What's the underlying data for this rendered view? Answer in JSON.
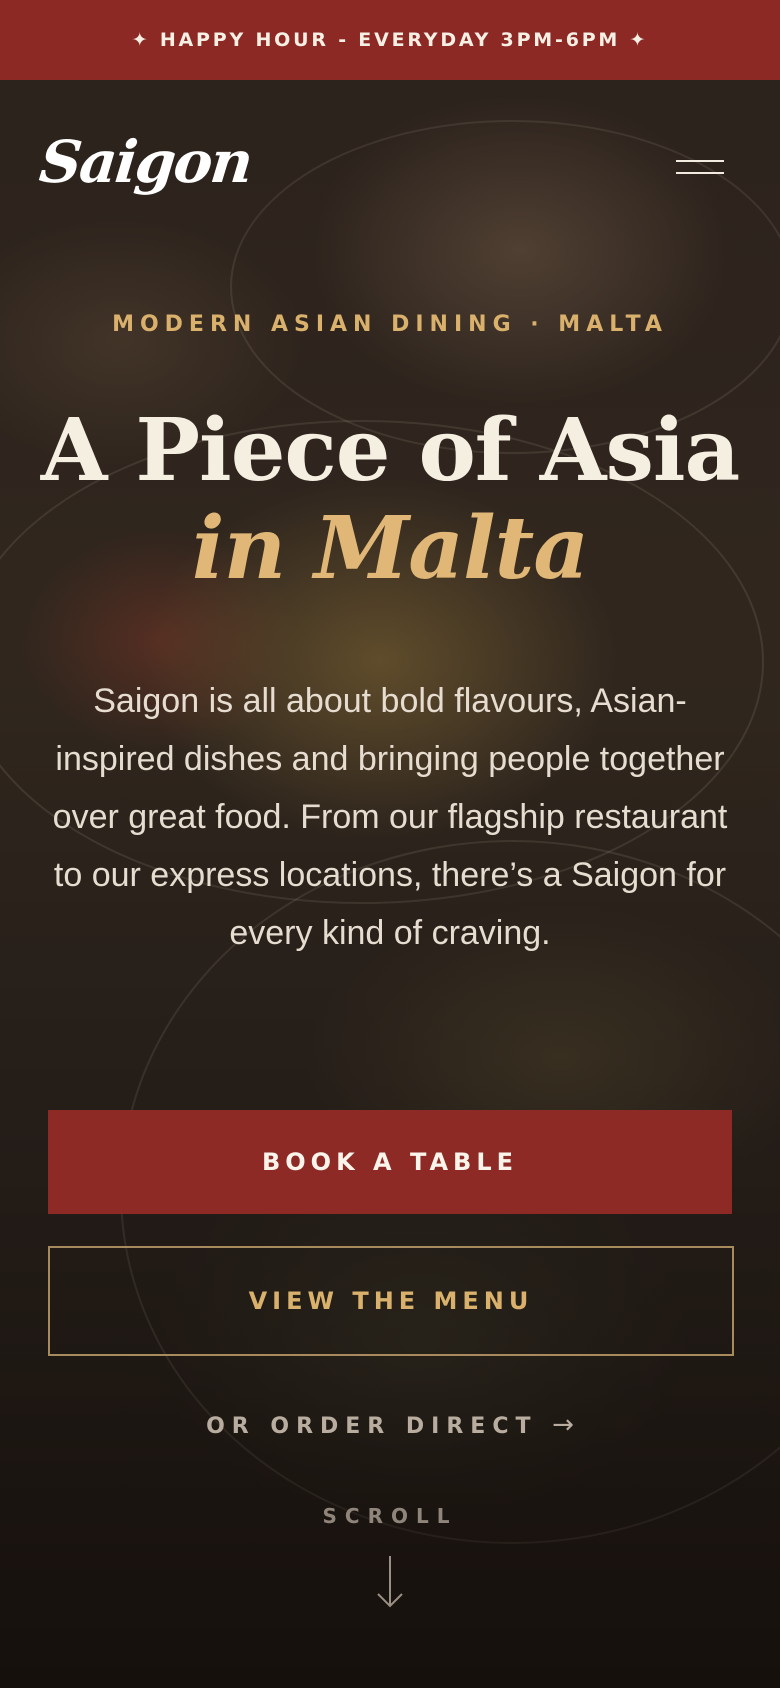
{
  "announcement": {
    "text": "✦ HAPPY HOUR - EVERYDAY 3PM-6PM ✦"
  },
  "header": {
    "logo_text": "Saigon",
    "menu_icon": "hamburger-menu-icon"
  },
  "hero": {
    "eyebrow": "MODERN ASIAN DINING · MALTA",
    "headline_line1": "A Piece of Asia",
    "headline_line2": "in Malta",
    "intro": "Saigon is all about bold flavours, Asian-inspired dishes and bringing people together over great food. From our flagship restaurant to our express locations, there’s a Saigon for every kind of craving.",
    "book_label": "BOOK A TABLE",
    "menu_label": "VIEW THE MENU",
    "order_label": "OR ORDER DIRECT",
    "order_arrow": "→",
    "scroll_label": "SCROLL",
    "scroll_icon": "arrow-down-icon"
  },
  "colors": {
    "brand_red": "#8c2924",
    "gold": "#d9b06c",
    "cream": "#f5efe2"
  }
}
